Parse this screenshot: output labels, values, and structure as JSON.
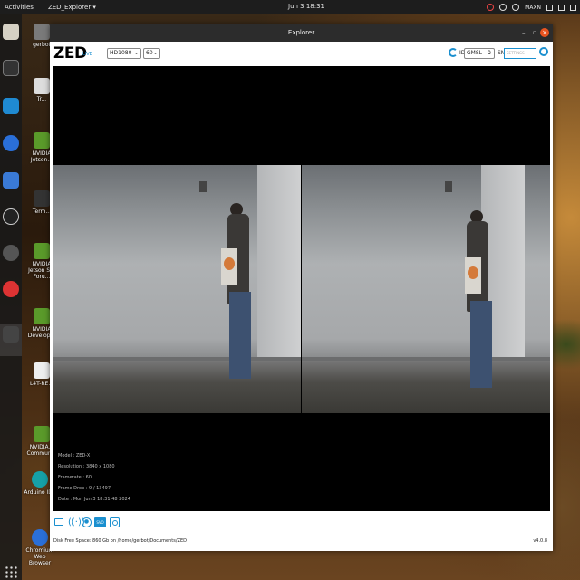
{
  "topbar": {
    "activities": "Activities",
    "app_menu": "ZED_Explorer ▾",
    "clock": "Jun 3  18:31",
    "power_mode": "MAXN"
  },
  "desktop_icons": [
    {
      "label": "gerbot",
      "icon": "home-folder-icon"
    },
    {
      "label": "Tr...",
      "icon": "trash-icon"
    },
    {
      "label": "NVIDIA Jetson...",
      "icon": "nvidia-icon"
    },
    {
      "label": "Term...",
      "icon": "terminal-icon"
    },
    {
      "label": "NVIDIA Jetson S... Foru...",
      "icon": "nvidia-icon"
    },
    {
      "label": "NVIDIA Develop...",
      "icon": "nvidia-icon"
    },
    {
      "label": "L4T-RE...",
      "icon": "doc-icon"
    },
    {
      "label": "NVIDIA... Commun...",
      "icon": "nvidia-icon"
    },
    {
      "label": "Arduino IDE",
      "icon": "arduino-icon"
    },
    {
      "label": "Chromium Web Browser",
      "icon": "chromium-icon"
    }
  ],
  "window": {
    "title": "Explorer",
    "minimize": "–",
    "maximize": "▫",
    "close": "×"
  },
  "toolbar": {
    "logo": "ZED",
    "live_badge": "LIVE",
    "resolution": "HD1080",
    "fps": "60",
    "id_label": "ID",
    "input": "GMSL - 0",
    "sn_label": "SN",
    "sn_placeholder": "SETTINGS"
  },
  "camera_info": {
    "model": "Model : ZED-X",
    "resolution": "Resolution : 3840 x 1080",
    "framerate": "Framerate : 60",
    "frame_drop": "Frame Drop : 9 / 13497",
    "date": "Date : Mon Jun 3 18:31:48 2024"
  },
  "footer": {
    "disk_free": "Disk Free Space: 860 Gb  on  /home/gerbot/Documents/ZED",
    "version": "v4.0.8"
  },
  "colors": {
    "accent": "#1a8fcf",
    "close_button": "#e95420",
    "titlebar": "#2c2c2c"
  }
}
